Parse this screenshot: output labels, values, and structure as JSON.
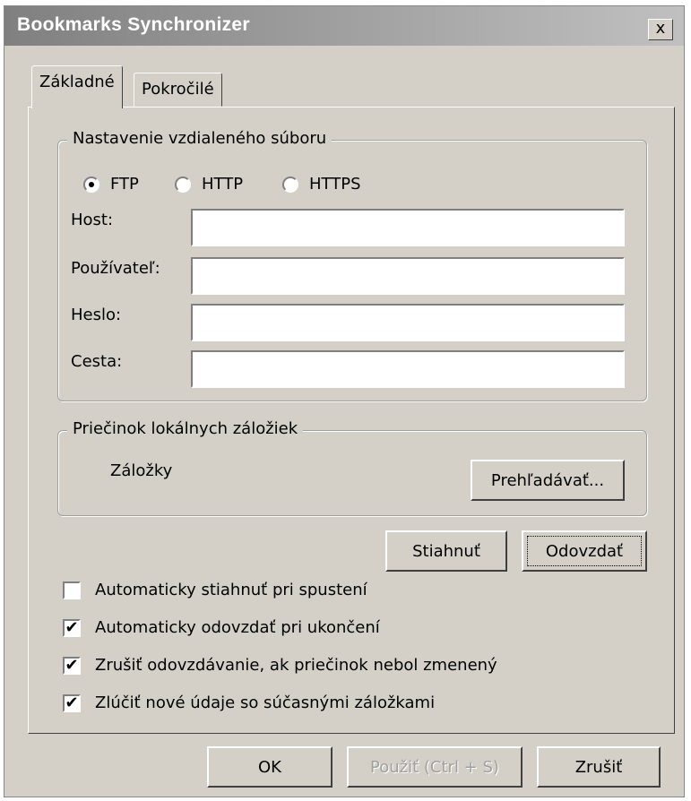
{
  "window": {
    "title": "Bookmarks Synchronizer",
    "close_label": "x"
  },
  "tabs": [
    {
      "label": "Základné",
      "active": true
    },
    {
      "label": "Pokročilé",
      "active": false
    }
  ],
  "remote_group": {
    "legend": "Nastavenie vzdialeného súboru",
    "protocols": [
      {
        "label": "FTP",
        "selected": true
      },
      {
        "label": "HTTP",
        "selected": false
      },
      {
        "label": "HTTPS",
        "selected": false
      }
    ],
    "fields": {
      "host_label": "Host:",
      "host_value": "",
      "user_label": "Používateľ:",
      "user_value": "",
      "password_label": "Heslo:",
      "password_value": "",
      "path_label": "Cesta:",
      "path_value": ""
    }
  },
  "local_group": {
    "legend": "Priečinok lokálnych záložiek",
    "folder_name": "Záložky",
    "browse_label": "Prehľadávať..."
  },
  "actions": {
    "download_label": "Stiahnuť",
    "upload_label": "Odovzdať"
  },
  "options": [
    {
      "label": "Automaticky stiahnuť pri spustení",
      "checked": false
    },
    {
      "label": "Automaticky odovzdať pri ukončení",
      "checked": true
    },
    {
      "label": "Zrušiť odovzdávanie, ak priečinok nebol zmenený",
      "checked": true
    },
    {
      "label": "Zlúčiť nové údaje so súčasnými záložkami",
      "checked": true
    }
  ],
  "footer": {
    "ok_label": "OK",
    "apply_label": "Použiť (Ctrl + S)",
    "cancel_label": "Zrušiť"
  },
  "check_mark": "✔"
}
